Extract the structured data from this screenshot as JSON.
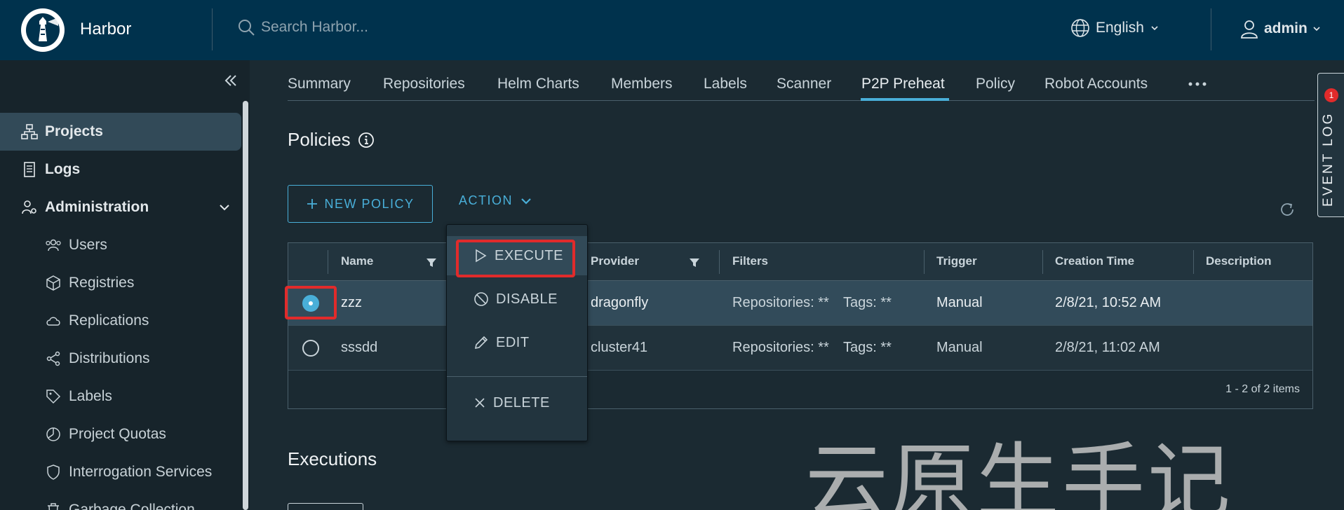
{
  "header": {
    "brand": "Harbor",
    "search_placeholder": "Search Harbor...",
    "language": "English",
    "user": "admin"
  },
  "sidebar": {
    "items": [
      {
        "label": "Projects"
      },
      {
        "label": "Logs"
      },
      {
        "label": "Administration"
      },
      {
        "label": "Users"
      },
      {
        "label": "Registries"
      },
      {
        "label": "Replications"
      },
      {
        "label": "Distributions"
      },
      {
        "label": "Labels"
      },
      {
        "label": "Project Quotas"
      },
      {
        "label": "Interrogation Services"
      },
      {
        "label": "Garbage Collection"
      }
    ]
  },
  "tabs": [
    "Summary",
    "Repositories",
    "Helm Charts",
    "Members",
    "Labels",
    "Scanner",
    "P2P Preheat",
    "Policy",
    "Robot Accounts"
  ],
  "policies": {
    "title": "Policies",
    "new_policy": "NEW POLICY",
    "action": "ACTION"
  },
  "table": {
    "headers": [
      "Name",
      "Provider",
      "Filters",
      "Trigger",
      "Creation Time",
      "Description"
    ],
    "rows": [
      {
        "name": "zzz",
        "provider": "dragonfly",
        "filter_repos": "Repositories: **",
        "filter_tags": "Tags: **",
        "trigger": "Manual",
        "created": "2/8/21, 10:52 AM"
      },
      {
        "name": "sssdd",
        "provider": "cluster41",
        "filter_repos": "Repositories: **",
        "filter_tags": "Tags: **",
        "trigger": "Manual",
        "created": "2/8/21, 11:02 AM"
      }
    ],
    "pager": "1 - 2 of 2 items"
  },
  "menu": {
    "execute": "EXECUTE",
    "disable": "DISABLE",
    "edit": "EDIT",
    "delete": "DELETE"
  },
  "executions": {
    "title": "Executions"
  },
  "event_log": {
    "label": "EVENT LOG",
    "count": "1"
  },
  "watermark": "云原生手记",
  "colors": {
    "accent": "#49afd9",
    "header": "#00324d",
    "highlight": "#e12b2b"
  }
}
